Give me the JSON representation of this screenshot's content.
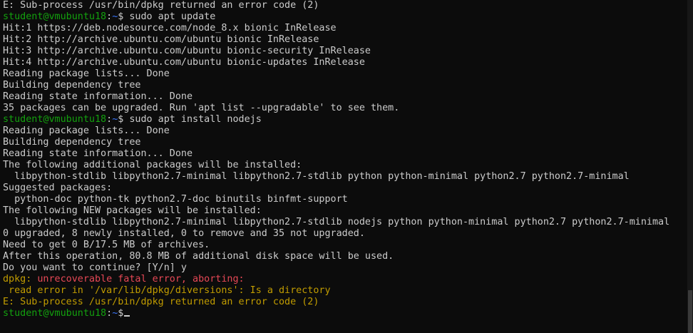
{
  "prompt": {
    "user": "student@vmubuntu18",
    "sep": ":",
    "path": "~",
    "symbol": "$"
  },
  "lines": [
    {
      "kind": "text",
      "text": "E: Sub-process /usr/bin/dpkg returned an error code (2)"
    },
    {
      "kind": "prompt",
      "command": " sudo apt update"
    },
    {
      "kind": "text",
      "text": "Hit:1 https://deb.nodesource.com/node_8.x bionic InRelease"
    },
    {
      "kind": "text",
      "text": "Hit:2 http://archive.ubuntu.com/ubuntu bionic InRelease"
    },
    {
      "kind": "text",
      "text": "Hit:3 http://archive.ubuntu.com/ubuntu bionic-security InRelease"
    },
    {
      "kind": "text",
      "text": "Hit:4 http://archive.ubuntu.com/ubuntu bionic-updates InRelease"
    },
    {
      "kind": "text",
      "text": "Reading package lists... Done"
    },
    {
      "kind": "text",
      "text": "Building dependency tree"
    },
    {
      "kind": "text",
      "text": "Reading state information... Done"
    },
    {
      "kind": "text",
      "text": "35 packages can be upgraded. Run 'apt list --upgradable' to see them."
    },
    {
      "kind": "prompt",
      "command": " sudo apt install nodejs"
    },
    {
      "kind": "text",
      "text": "Reading package lists... Done"
    },
    {
      "kind": "text",
      "text": "Building dependency tree"
    },
    {
      "kind": "text",
      "text": "Reading state information... Done"
    },
    {
      "kind": "text",
      "text": "The following additional packages will be installed:"
    },
    {
      "kind": "text",
      "text": "  libpython-stdlib libpython2.7-minimal libpython2.7-stdlib python python-minimal python2.7 python2.7-minimal"
    },
    {
      "kind": "text",
      "text": "Suggested packages:"
    },
    {
      "kind": "text",
      "text": "  python-doc python-tk python2.7-doc binutils binfmt-support"
    },
    {
      "kind": "text",
      "text": "The following NEW packages will be installed:"
    },
    {
      "kind": "text",
      "text": "  libpython-stdlib libpython2.7-minimal libpython2.7-stdlib nodejs python python-minimal python2.7 python2.7-minimal"
    },
    {
      "kind": "text",
      "text": "0 upgraded, 8 newly installed, 0 to remove and 35 not upgraded."
    },
    {
      "kind": "text",
      "text": "Need to get 0 B/17.5 MB of archives."
    },
    {
      "kind": "text",
      "text": "After this operation, 80.8 MB of additional disk space will be used."
    },
    {
      "kind": "text",
      "text": "Do you want to continue? [Y/n] y"
    },
    {
      "kind": "dpkg",
      "prefix": "dpkg:",
      "text": " unrecoverable fatal error, aborting:"
    },
    {
      "kind": "warn",
      "text": " read error in '/var/lib/dpkg/diversions': Is a directory"
    },
    {
      "kind": "warn",
      "text": "E: Sub-process /usr/bin/dpkg returned an error code (2)"
    },
    {
      "kind": "prompt",
      "command": "",
      "cursor": true
    }
  ],
  "colors": {
    "background": "#0c0c0c",
    "foreground": "#cccccc",
    "user": "#13a10e",
    "path": "#3b78ff",
    "error": "#e74856",
    "warning": "#c19c00"
  }
}
